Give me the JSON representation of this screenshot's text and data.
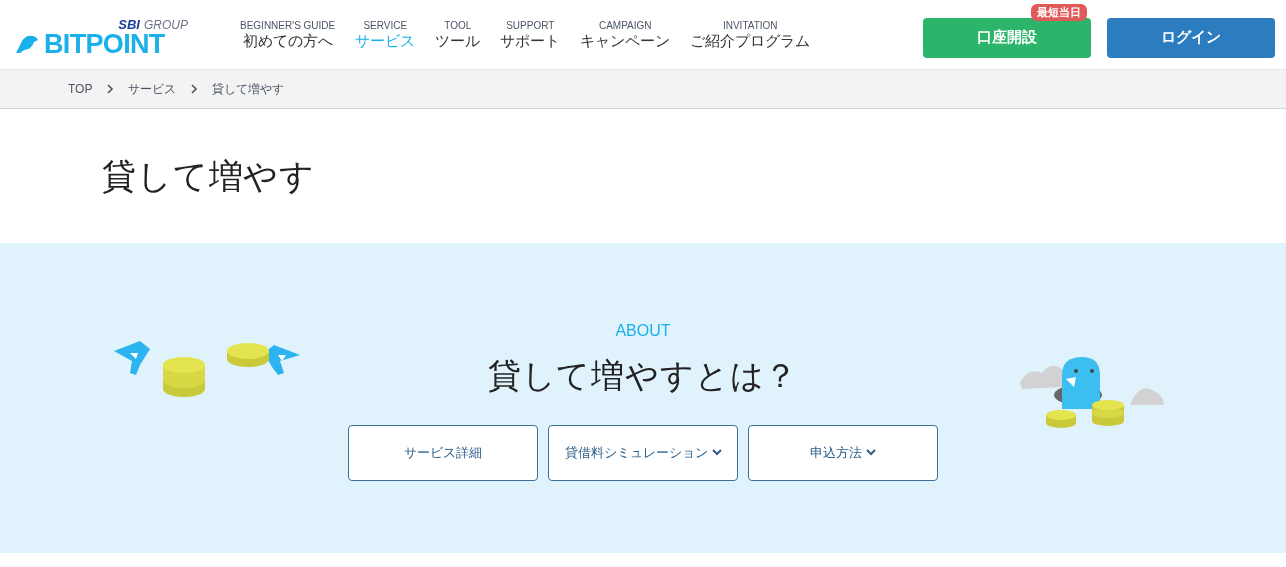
{
  "logo": {
    "group": "SBI",
    "group_suffix": "GROUP",
    "name": "BITPOINT"
  },
  "nav": [
    {
      "sub": "BEGINNER'S GUIDE",
      "label": "初めての方へ",
      "selected": false
    },
    {
      "sub": "SERVICE",
      "label": "サービス",
      "selected": true
    },
    {
      "sub": "TOOL",
      "label": "ツール",
      "selected": false
    },
    {
      "sub": "SUPPORT",
      "label": "サポート",
      "selected": false
    },
    {
      "sub": "CAMPAIGN",
      "label": "キャンペーン",
      "selected": false
    },
    {
      "sub": "INVITATION",
      "label": "ご紹介プログラム",
      "selected": false
    }
  ],
  "open_account": {
    "label": "口座開設",
    "badge": "最短当日"
  },
  "login": {
    "label": "ログイン"
  },
  "breadcrumb": [
    "TOP",
    "サービス",
    "貸して増やす"
  ],
  "page_title": "貸して増やす",
  "about": {
    "eyebrow": "ABOUT",
    "heading": "貸して増やすとは？",
    "buttons": [
      {
        "label": "サービス詳細",
        "has_dropdown": false
      },
      {
        "label": "貸借料シミュレーション",
        "has_dropdown": true
      },
      {
        "label": "申込方法",
        "has_dropdown": true
      }
    ]
  }
}
